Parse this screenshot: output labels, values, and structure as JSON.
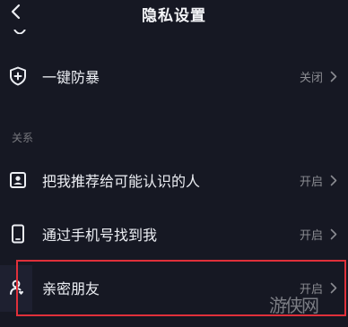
{
  "header": {
    "title": "隐私设置"
  },
  "rows": {
    "anti_violence": {
      "label": "一键防暴",
      "value": "关闭"
    },
    "recommend": {
      "label": "把我推荐给可能认识的人",
      "value": "开启"
    },
    "phone": {
      "label": "通过手机号找到我",
      "value": "开启"
    },
    "close_friends": {
      "label": "亲密朋友",
      "value": "开启"
    }
  },
  "sections": {
    "relations": "关系"
  },
  "watermark": {
    "text": "游侠网"
  }
}
